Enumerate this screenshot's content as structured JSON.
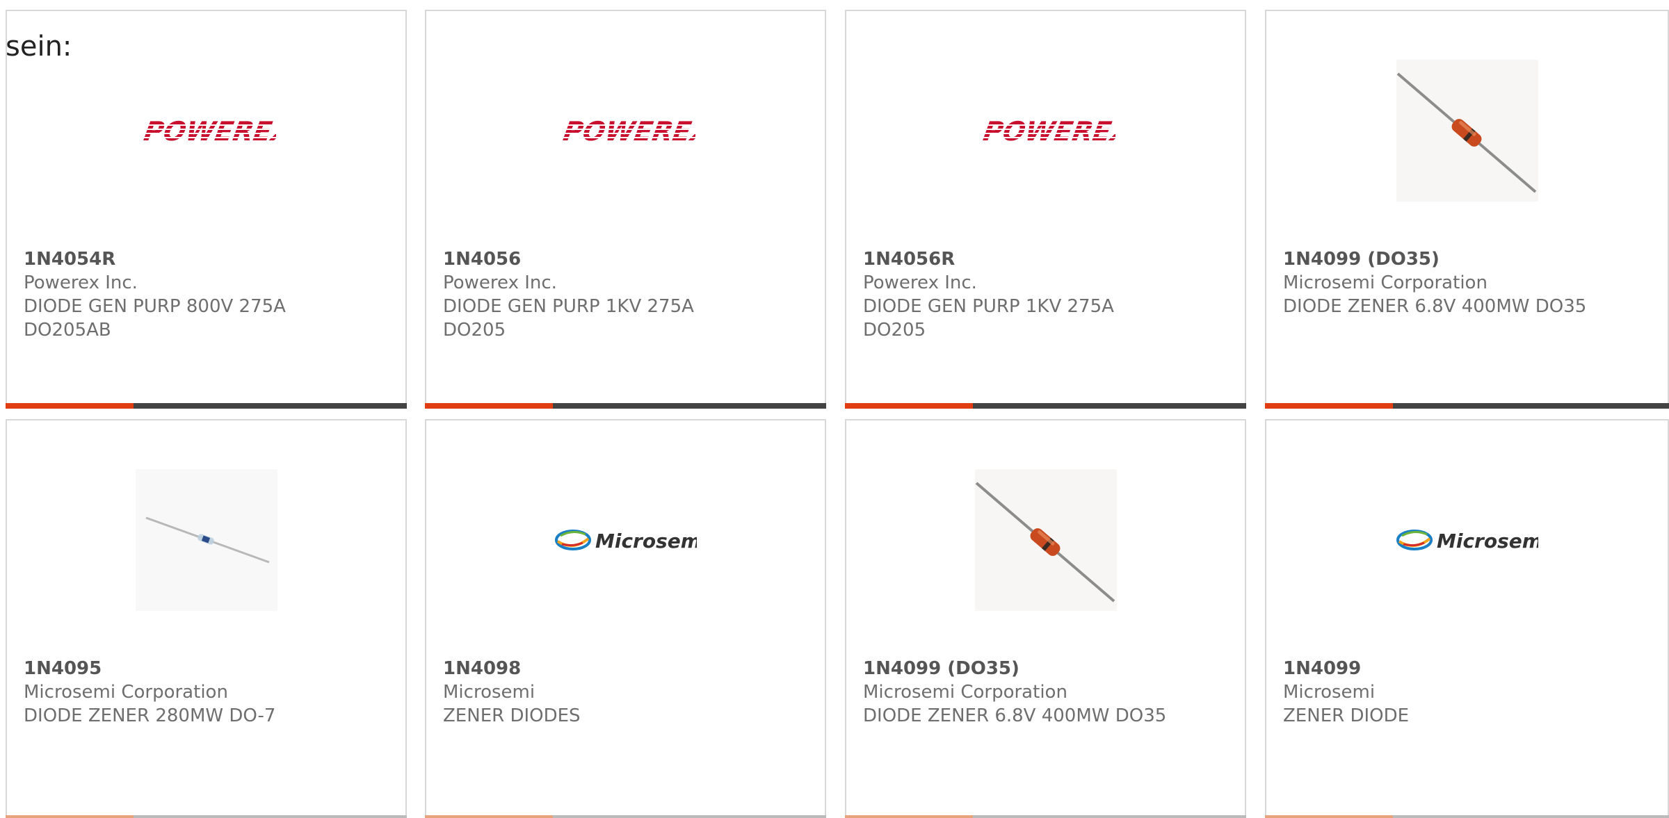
{
  "intro_text": "sein:",
  "colors": {
    "accent": "#e03e12",
    "bar_dark": "#434343",
    "powerex_red": "#c8102e"
  },
  "products": [
    {
      "part_number": "1N4054R",
      "manufacturer": "Powerex Inc.",
      "description_line1": "DIODE GEN PURP 800V 275A",
      "description_line2": "DO205AB",
      "image": "powerex-logo",
      "logo_text": "POWEREX"
    },
    {
      "part_number": "1N4056",
      "manufacturer": "Powerex Inc.",
      "description_line1": "DIODE GEN PURP 1KV 275A",
      "description_line2": "DO205",
      "image": "powerex-logo",
      "logo_text": "POWEREX"
    },
    {
      "part_number": "1N4056R",
      "manufacturer": "Powerex Inc.",
      "description_line1": "DIODE GEN PURP 1KV 275A",
      "description_line2": "DO205",
      "image": "powerex-logo",
      "logo_text": "POWEREX"
    },
    {
      "part_number": "1N4099 (DO35)",
      "manufacturer": "Microsemi Corporation",
      "description_line1": "DIODE ZENER 6.8V 400MW DO35",
      "description_line2": "",
      "image": "diode-photo-orange"
    },
    {
      "part_number": "1N4095",
      "manufacturer": "Microsemi Corporation",
      "description_line1": "DIODE ZENER 280MW DO-7",
      "description_line2": "",
      "image": "diode-photo-glass"
    },
    {
      "part_number": "1N4098",
      "manufacturer": "Microsemi",
      "description_line1": "ZENER DIODES",
      "description_line2": "",
      "image": "microsemi-logo",
      "logo_text": "Microsemi"
    },
    {
      "part_number": "1N4099 (DO35)",
      "manufacturer": "Microsemi Corporation",
      "description_line1": "DIODE ZENER 6.8V 400MW DO35",
      "description_line2": "",
      "image": "diode-photo-orange"
    },
    {
      "part_number": "1N4099",
      "manufacturer": "Microsemi",
      "description_line1": "ZENER DIODE",
      "description_line2": "",
      "image": "microsemi-logo",
      "logo_text": "Microsemi"
    }
  ]
}
